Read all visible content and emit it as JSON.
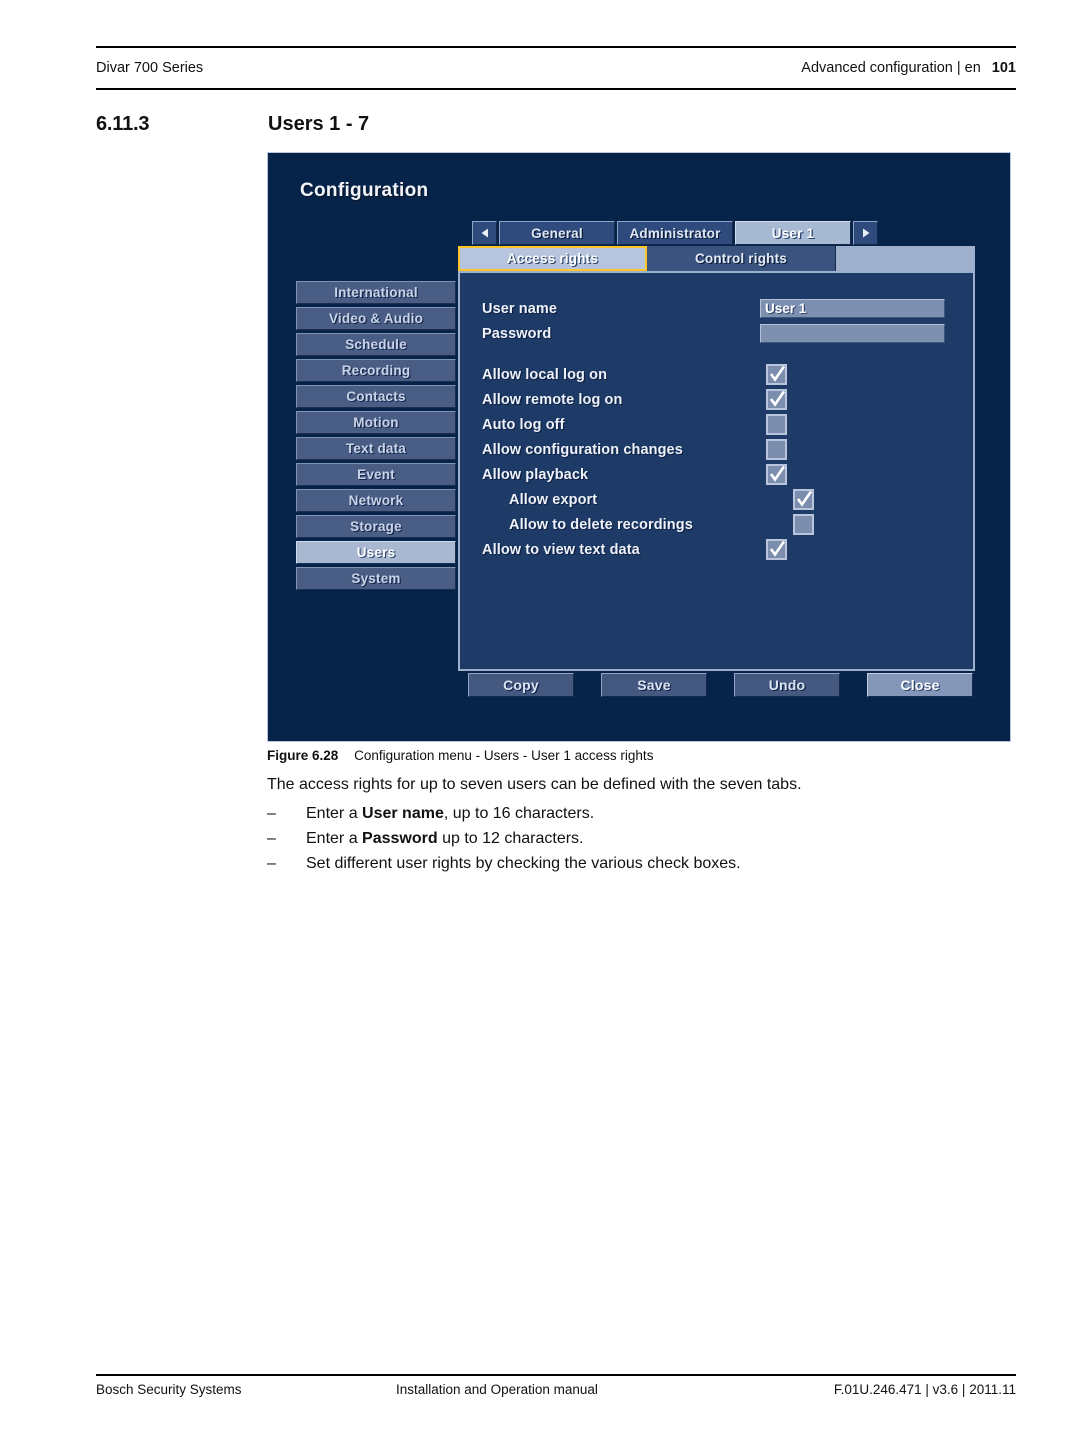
{
  "header": {
    "left": "Divar 700 Series",
    "right": "Advanced configuration | en",
    "page_number": "101"
  },
  "section": {
    "number": "6.11.3",
    "title": "Users 1 - 7"
  },
  "osd": {
    "title": "Configuration",
    "nav_prev_icon": "left-triangle-icon",
    "nav_next_icon": "right-triangle-icon",
    "top_tabs": [
      {
        "label": "General",
        "active": false
      },
      {
        "label": "Administrator",
        "active": false
      },
      {
        "label": "User 1",
        "active": true
      }
    ],
    "sub_tabs": [
      {
        "label": "Access rights",
        "active": true
      },
      {
        "label": "Control rights",
        "active": false
      }
    ],
    "sidebar": [
      {
        "label": "International",
        "active": false
      },
      {
        "label": "Video & Audio",
        "active": false
      },
      {
        "label": "Schedule",
        "active": false
      },
      {
        "label": "Recording",
        "active": false
      },
      {
        "label": "Contacts",
        "active": false
      },
      {
        "label": "Motion",
        "active": false
      },
      {
        "label": "Text data",
        "active": false
      },
      {
        "label": "Event",
        "active": false
      },
      {
        "label": "Network",
        "active": false
      },
      {
        "label": "Storage",
        "active": false
      },
      {
        "label": "Users",
        "active": true
      },
      {
        "label": "System",
        "active": false
      }
    ],
    "fields": [
      {
        "label": "User name",
        "value": "User 1"
      },
      {
        "label": "Password",
        "value": ""
      }
    ],
    "checkboxes": [
      {
        "label": "Allow local log on",
        "checked": true,
        "indent": false
      },
      {
        "label": "Allow remote log on",
        "checked": true,
        "indent": false
      },
      {
        "label": "Auto log off",
        "checked": false,
        "indent": false
      },
      {
        "label": "Allow configuration changes",
        "checked": false,
        "indent": false
      },
      {
        "label": "Allow playback",
        "checked": true,
        "indent": false
      },
      {
        "label": "Allow export",
        "checked": true,
        "indent": true
      },
      {
        "label": "Allow to delete recordings",
        "checked": false,
        "indent": true
      },
      {
        "label": "Allow to view text data",
        "checked": true,
        "indent": false
      }
    ],
    "buttons": [
      {
        "label": "Copy",
        "primary": false
      },
      {
        "label": "Save",
        "primary": false
      },
      {
        "label": "Undo",
        "primary": false
      },
      {
        "label": "Close",
        "primary": true
      }
    ],
    "colors": {
      "dialog_bg": "#062349",
      "panel_bg": "#1e3a66",
      "panel_border": "#9db0ce",
      "tab_inactive": "#2f4a7d",
      "tab_active": "#a8b9d4",
      "highlight_outline": "#ffc425",
      "sidebar_item": "#4a5e85",
      "sidebar_active": "#a8b8d0",
      "field_bg": "#7d90b0",
      "button_bg": "#445880",
      "button_primary": "#8396b8"
    }
  },
  "caption": {
    "figure_label": "Figure",
    "figure_number": "6.28",
    "text": "Configuration menu - Users - User 1 access rights"
  },
  "body": {
    "intro": "The access rights for up to seven users can be defined with the seven tabs.",
    "dash": "–",
    "bullets": [
      {
        "pre": "Enter a ",
        "bold": "User name",
        "post": ", up to 16 characters."
      },
      {
        "pre": "Enter a ",
        "bold": "Password",
        "post": " up to 12 characters."
      },
      {
        "pre": "Set different user rights by checking the various check boxes.",
        "bold": "",
        "post": ""
      }
    ]
  },
  "footer": {
    "left": "Bosch Security Systems",
    "middle": "Installation and Operation manual",
    "right": "F.01U.246.471 | v3.6 | 2011.11"
  }
}
